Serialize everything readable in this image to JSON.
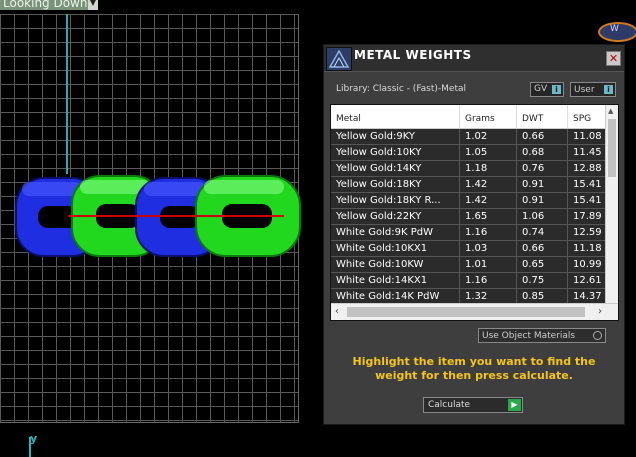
{
  "viewport": {
    "view_label": "Looking Down",
    "axis_label": "y"
  },
  "gizmo_label": "W",
  "panel": {
    "title": "METAL WEIGHTS",
    "library_label": "Library: Classic - (Fast)-Metal",
    "gv_label": "GV",
    "user_label": "User",
    "info_glyph": "i",
    "columns": [
      "Metal",
      "Grams",
      "DWT",
      "SPG"
    ],
    "rows": [
      [
        "Yellow Gold:9KY",
        "1.02",
        "0.66",
        "11.08"
      ],
      [
        "Yellow Gold:10KY",
        "1.05",
        "0.68",
        "11.45"
      ],
      [
        "Yellow Gold:14KY",
        "1.18",
        "0.76",
        "12.88"
      ],
      [
        "Yellow Gold:18KY",
        "1.42",
        "0.91",
        "15.41"
      ],
      [
        "Yellow Gold:18KY R...",
        "1.42",
        "0.91",
        "15.41"
      ],
      [
        "Yellow Gold:22KY",
        "1.65",
        "1.06",
        "17.89"
      ],
      [
        "White Gold:9K PdW",
        "1.16",
        "0.74",
        "12.59"
      ],
      [
        "White Gold:10KX1",
        "1.03",
        "0.66",
        "11.18"
      ],
      [
        "White Gold:10KW",
        "1.01",
        "0.65",
        "10.99"
      ],
      [
        "White Gold:14KX1",
        "1.16",
        "0.75",
        "12.61"
      ],
      [
        "White Gold:14K PdW",
        "1.32",
        "0.85",
        "14.37"
      ]
    ],
    "use_object_materials": "Use Object Materials",
    "instructions": "Highlight the item you want to find the weight for then press calculate.",
    "calculate_label": "Calculate",
    "calculate_glyph": "▶"
  },
  "colors": {
    "instructions": "#f5c518",
    "link_blue": "#1f2ee0",
    "link_green": "#22d81f",
    "axis_cyan": "#2aa7b0",
    "axis_red": "#cc0000"
  },
  "icons": {
    "close": "close-icon",
    "app": "metal-weights-app-icon",
    "info": "info-icon",
    "calculate": "play-icon"
  }
}
